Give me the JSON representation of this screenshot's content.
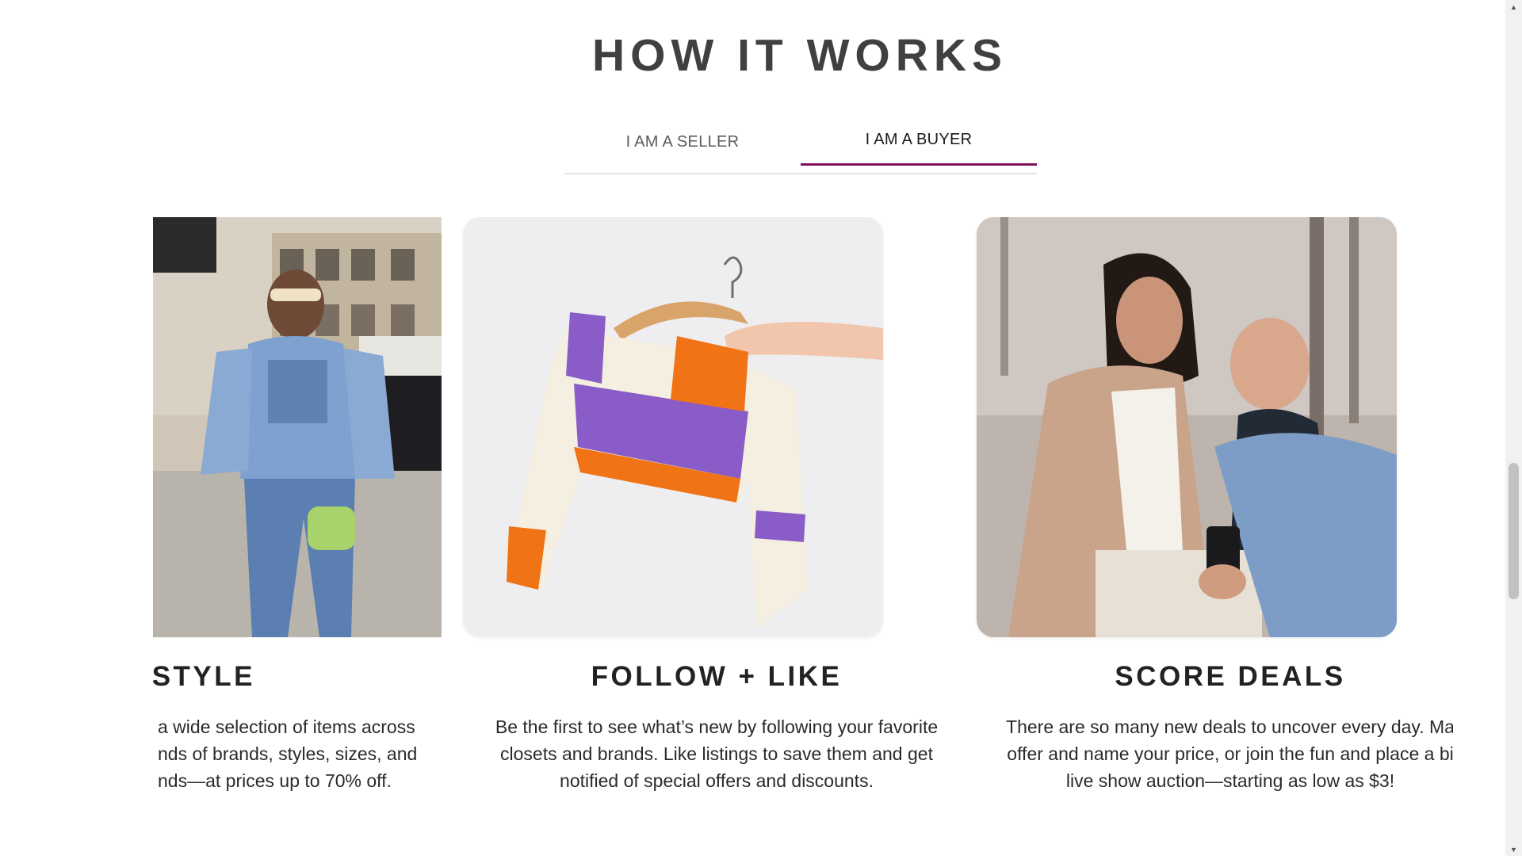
{
  "section": {
    "title": "HOW IT WORKS"
  },
  "tabs": {
    "seller_label": "I AM A SELLER",
    "buyer_label": "I AM A BUYER",
    "active": "buyer",
    "accent_color": "#7f0f5b"
  },
  "cards": [
    {
      "title": "ND YOUR STYLE",
      "description": "a wide selection of items across nds of brands, styles, sizes, and nds—at prices up to 70% off.",
      "lines": [
        "a wide selection of items across",
        "nds of brands, styles, sizes, and",
        "nds—at prices up to 70% off."
      ],
      "image": "street-style-denim-photo"
    },
    {
      "title": "FOLLOW + LIKE",
      "description": "Be the first to see what’s new by following your favorite closets and brands. Like listings to save them and get notified of special offers and discounts.",
      "lines": [
        "Be the first to see what’s new by following your favorite",
        "closets and brands. Like listings to save them and get",
        "notified of special offers and discounts."
      ],
      "image": "crochet-sweater-on-hanger-photo"
    },
    {
      "title": "SCORE DEALS",
      "description": "There are so many new deals to uncover every day. Ma offer and name your price, or join the fun and place a bi live show auction—starting as low as $3!",
      "lines": [
        "There are so many new deals to uncover every day. Ma",
        "offer and name your price, or join the fun and place a bi",
        "live show auction—starting as low as $3!"
      ],
      "image": "couple-looking-at-phone-photo"
    }
  ],
  "scrollbar": {
    "up_icon": "triangle-up-icon",
    "down_icon": "triangle-down-icon"
  }
}
